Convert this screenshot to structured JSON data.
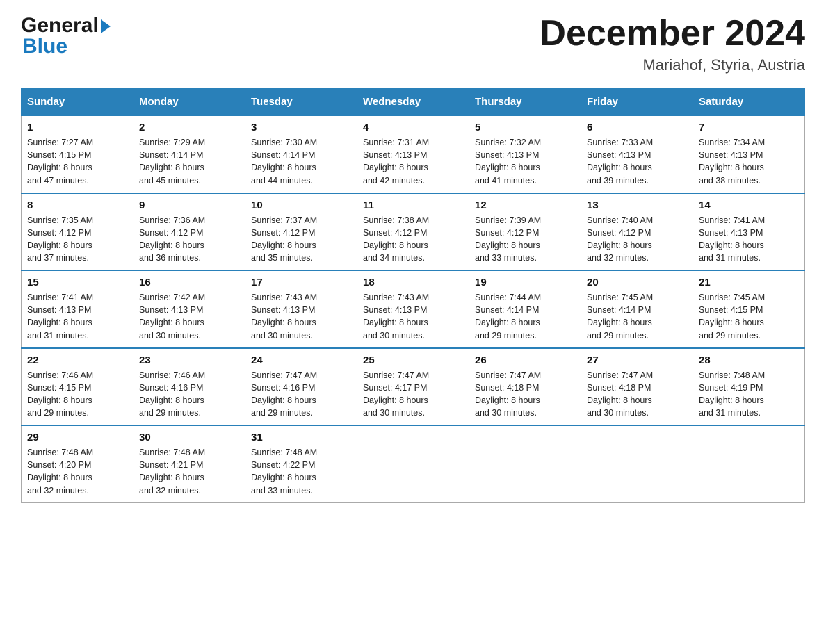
{
  "header": {
    "logo_text1": "General",
    "logo_text2": "Blue",
    "month_year": "December 2024",
    "location": "Mariahof, Styria, Austria"
  },
  "days_of_week": [
    "Sunday",
    "Monday",
    "Tuesday",
    "Wednesday",
    "Thursday",
    "Friday",
    "Saturday"
  ],
  "weeks": [
    [
      {
        "day": "1",
        "sunrise": "7:27 AM",
        "sunset": "4:15 PM",
        "daylight": "8 hours and 47 minutes."
      },
      {
        "day": "2",
        "sunrise": "7:29 AM",
        "sunset": "4:14 PM",
        "daylight": "8 hours and 45 minutes."
      },
      {
        "day": "3",
        "sunrise": "7:30 AM",
        "sunset": "4:14 PM",
        "daylight": "8 hours and 44 minutes."
      },
      {
        "day": "4",
        "sunrise": "7:31 AM",
        "sunset": "4:13 PM",
        "daylight": "8 hours and 42 minutes."
      },
      {
        "day": "5",
        "sunrise": "7:32 AM",
        "sunset": "4:13 PM",
        "daylight": "8 hours and 41 minutes."
      },
      {
        "day": "6",
        "sunrise": "7:33 AM",
        "sunset": "4:13 PM",
        "daylight": "8 hours and 39 minutes."
      },
      {
        "day": "7",
        "sunrise": "7:34 AM",
        "sunset": "4:13 PM",
        "daylight": "8 hours and 38 minutes."
      }
    ],
    [
      {
        "day": "8",
        "sunrise": "7:35 AM",
        "sunset": "4:12 PM",
        "daylight": "8 hours and 37 minutes."
      },
      {
        "day": "9",
        "sunrise": "7:36 AM",
        "sunset": "4:12 PM",
        "daylight": "8 hours and 36 minutes."
      },
      {
        "day": "10",
        "sunrise": "7:37 AM",
        "sunset": "4:12 PM",
        "daylight": "8 hours and 35 minutes."
      },
      {
        "day": "11",
        "sunrise": "7:38 AM",
        "sunset": "4:12 PM",
        "daylight": "8 hours and 34 minutes."
      },
      {
        "day": "12",
        "sunrise": "7:39 AM",
        "sunset": "4:12 PM",
        "daylight": "8 hours and 33 minutes."
      },
      {
        "day": "13",
        "sunrise": "7:40 AM",
        "sunset": "4:12 PM",
        "daylight": "8 hours and 32 minutes."
      },
      {
        "day": "14",
        "sunrise": "7:41 AM",
        "sunset": "4:13 PM",
        "daylight": "8 hours and 31 minutes."
      }
    ],
    [
      {
        "day": "15",
        "sunrise": "7:41 AM",
        "sunset": "4:13 PM",
        "daylight": "8 hours and 31 minutes."
      },
      {
        "day": "16",
        "sunrise": "7:42 AM",
        "sunset": "4:13 PM",
        "daylight": "8 hours and 30 minutes."
      },
      {
        "day": "17",
        "sunrise": "7:43 AM",
        "sunset": "4:13 PM",
        "daylight": "8 hours and 30 minutes."
      },
      {
        "day": "18",
        "sunrise": "7:43 AM",
        "sunset": "4:13 PM",
        "daylight": "8 hours and 30 minutes."
      },
      {
        "day": "19",
        "sunrise": "7:44 AM",
        "sunset": "4:14 PM",
        "daylight": "8 hours and 29 minutes."
      },
      {
        "day": "20",
        "sunrise": "7:45 AM",
        "sunset": "4:14 PM",
        "daylight": "8 hours and 29 minutes."
      },
      {
        "day": "21",
        "sunrise": "7:45 AM",
        "sunset": "4:15 PM",
        "daylight": "8 hours and 29 minutes."
      }
    ],
    [
      {
        "day": "22",
        "sunrise": "7:46 AM",
        "sunset": "4:15 PM",
        "daylight": "8 hours and 29 minutes."
      },
      {
        "day": "23",
        "sunrise": "7:46 AM",
        "sunset": "4:16 PM",
        "daylight": "8 hours and 29 minutes."
      },
      {
        "day": "24",
        "sunrise": "7:47 AM",
        "sunset": "4:16 PM",
        "daylight": "8 hours and 29 minutes."
      },
      {
        "day": "25",
        "sunrise": "7:47 AM",
        "sunset": "4:17 PM",
        "daylight": "8 hours and 30 minutes."
      },
      {
        "day": "26",
        "sunrise": "7:47 AM",
        "sunset": "4:18 PM",
        "daylight": "8 hours and 30 minutes."
      },
      {
        "day": "27",
        "sunrise": "7:47 AM",
        "sunset": "4:18 PM",
        "daylight": "8 hours and 30 minutes."
      },
      {
        "day": "28",
        "sunrise": "7:48 AM",
        "sunset": "4:19 PM",
        "daylight": "8 hours and 31 minutes."
      }
    ],
    [
      {
        "day": "29",
        "sunrise": "7:48 AM",
        "sunset": "4:20 PM",
        "daylight": "8 hours and 32 minutes."
      },
      {
        "day": "30",
        "sunrise": "7:48 AM",
        "sunset": "4:21 PM",
        "daylight": "8 hours and 32 minutes."
      },
      {
        "day": "31",
        "sunrise": "7:48 AM",
        "sunset": "4:22 PM",
        "daylight": "8 hours and 33 minutes."
      },
      null,
      null,
      null,
      null
    ]
  ],
  "labels": {
    "sunrise": "Sunrise:",
    "sunset": "Sunset:",
    "daylight": "Daylight:"
  },
  "colors": {
    "header_bg": "#2980b9",
    "header_text": "#ffffff",
    "border": "#2980b9"
  }
}
